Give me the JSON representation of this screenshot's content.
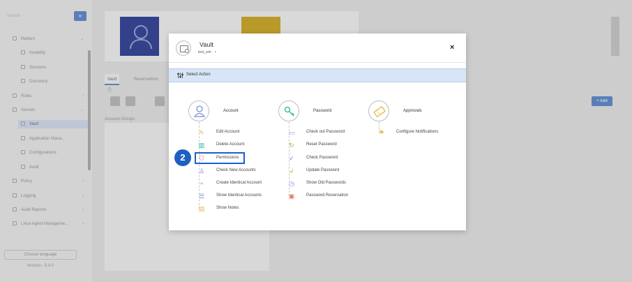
{
  "sidebar": {
    "search_placeholder": "Search",
    "search_button": "«",
    "items": [
      {
        "label": "Matters",
        "chevron": "⌄"
      },
      {
        "label": "Invalidity"
      },
      {
        "label": "Sessions"
      },
      {
        "label": "Discovery"
      },
      {
        "label": "Roles",
        "chevron": "›"
      },
      {
        "label": "Secrets",
        "chevron": "⌄"
      },
      {
        "label": "Vault"
      },
      {
        "label": "Application Mana..."
      },
      {
        "label": "Configurations"
      },
      {
        "label": "Audit"
      },
      {
        "label": "Policy",
        "chevron": "›"
      },
      {
        "label": "Logging",
        "chevron": "›"
      },
      {
        "label": "Audit Reports",
        "chevron": "›"
      },
      {
        "label": "Linux Agent Manageme...",
        "chevron": "›"
      }
    ],
    "language_button": "Choose language",
    "version": "Version - 5.4.0"
  },
  "background": {
    "tabs": [
      "Vault ⓘ",
      "Reservations"
    ],
    "add_button": "+ Add",
    "panel_label": "Account Groups"
  },
  "modal": {
    "title": "Vault",
    "subtitle": "test_ssh",
    "subtitle_extra": "•",
    "close_label": "×",
    "action_bar_label": "Select Action",
    "groups": [
      {
        "title": "Account",
        "icon": "user-icon",
        "actions": [
          {
            "label": "Edit Account",
            "icon": "pencil-icon",
            "color": "#e8b84a"
          },
          {
            "label": "Delete Account",
            "icon": "trash-icon",
            "color": "#2bb39a"
          },
          {
            "label": "Permissions",
            "icon": "shield-icon",
            "color": "#e06a6a"
          },
          {
            "label": "Check New Accounts",
            "icon": "user-search-icon",
            "color": "#8a7fd9"
          },
          {
            "label": "Create Identical Account",
            "icon": "plus-icon",
            "color": "#8fc14a"
          },
          {
            "label": "Show Identical Accounts",
            "icon": "list-icon",
            "color": "#7a8fd9"
          },
          {
            "label": "Show Notes",
            "icon": "folder-icon",
            "color": "#e8b84a"
          }
        ]
      },
      {
        "title": "Password",
        "icon": "key-icon",
        "actions": [
          {
            "label": "Check out Password",
            "icon": "checkout-icon",
            "color": "#c67ad9"
          },
          {
            "label": "Reset Password",
            "icon": "refresh-icon",
            "color": "#8fc14a"
          },
          {
            "label": "Check Password",
            "icon": "check-icon",
            "color": "#6a7fd9"
          },
          {
            "label": "Update Password",
            "icon": "return-icon",
            "color": "#e8b84a"
          },
          {
            "label": "Show Old Passwords",
            "icon": "history-icon",
            "color": "#a67ad9"
          },
          {
            "label": "Password Reservation",
            "icon": "calendar-icon",
            "color": "#e07a5a"
          }
        ]
      },
      {
        "title": "Approvals",
        "icon": "ticket-icon",
        "actions": [
          {
            "label": "Configure Notifications",
            "icon": "bell-icon",
            "color": "#e8b84a"
          }
        ]
      }
    ]
  },
  "step_badge": "2",
  "colors": {
    "accent": "#1f5fc4",
    "action_bar_bg": "#d7e5f7",
    "overlay_bg": "#c9c9c9"
  }
}
